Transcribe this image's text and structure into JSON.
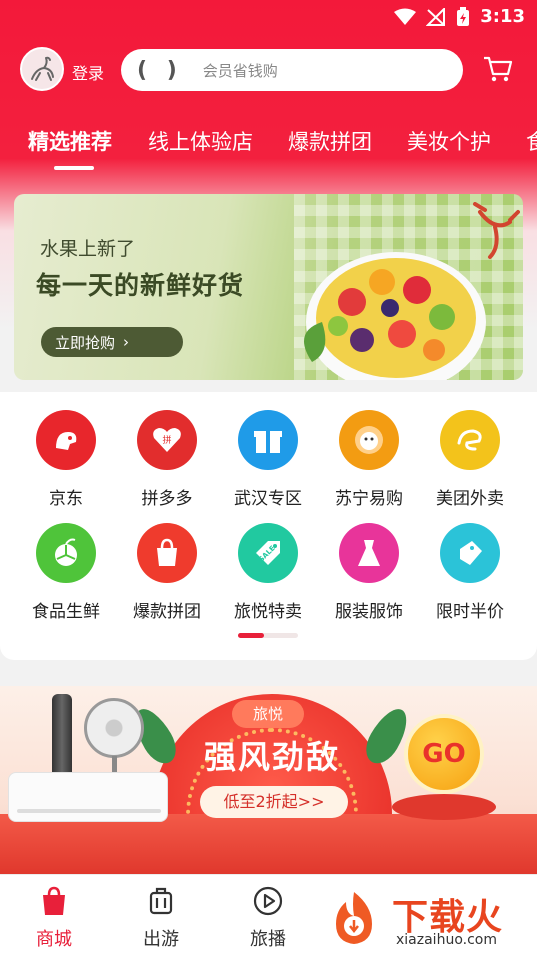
{
  "status_bar": {
    "time": "3:13"
  },
  "header": {
    "login_label": "登录",
    "search_placeholder": "会员省钱购"
  },
  "tabs": [
    {
      "label": "精选推荐",
      "active": true
    },
    {
      "label": "线上体验店",
      "active": false
    },
    {
      "label": "爆款拼团",
      "active": false
    },
    {
      "label": "美妆个护",
      "active": false
    },
    {
      "label": "食",
      "active": false
    }
  ],
  "banner": {
    "subtitle": "水果上新了",
    "title": "每一天的新鲜好货",
    "button_label": "立即抢购"
  },
  "categories": [
    {
      "label": "京东",
      "icon": "jd-dog-icon",
      "color": "#e8262c"
    },
    {
      "label": "拼多多",
      "icon": "pinduoduo-heart-icon",
      "color": "#e22d2d"
    },
    {
      "label": "武汉专区",
      "icon": "gift-box-icon",
      "color": "#1f9be8"
    },
    {
      "label": "苏宁易购",
      "icon": "suning-lion-icon",
      "color": "#f39c12"
    },
    {
      "label": "美团外卖",
      "icon": "meituan-kangaroo-icon",
      "color": "#f3c31b"
    },
    {
      "label": "食品生鲜",
      "icon": "orange-fruit-icon",
      "color": "#4fc43a"
    },
    {
      "label": "爆款拼团",
      "icon": "shopping-bag-icon",
      "color": "#ef3b2d"
    },
    {
      "label": "旅悦特卖",
      "icon": "sale-tag-icon",
      "color": "#21c9a0"
    },
    {
      "label": "服装服饰",
      "icon": "dress-icon",
      "color": "#e8349a"
    },
    {
      "label": "限时半价",
      "icon": "half-price-tag-icon",
      "color": "#2bc3d8"
    }
  ],
  "promo": {
    "tag": "旅悦",
    "title": "强风劲敌",
    "subtitle": "低至2折起>>",
    "go_label": "GO"
  },
  "bottom_nav": [
    {
      "label": "商城",
      "icon": "shop-bag-icon",
      "active": true
    },
    {
      "label": "出游",
      "icon": "luggage-icon",
      "active": false
    },
    {
      "label": "旅播",
      "icon": "play-icon",
      "active": false
    }
  ],
  "watermark": {
    "text": "下载火",
    "url": "xiazaihuo.com"
  },
  "colors": {
    "brand_red": "#f3193a",
    "active_red": "#e8203a",
    "banner_button": "#4d5a34"
  }
}
